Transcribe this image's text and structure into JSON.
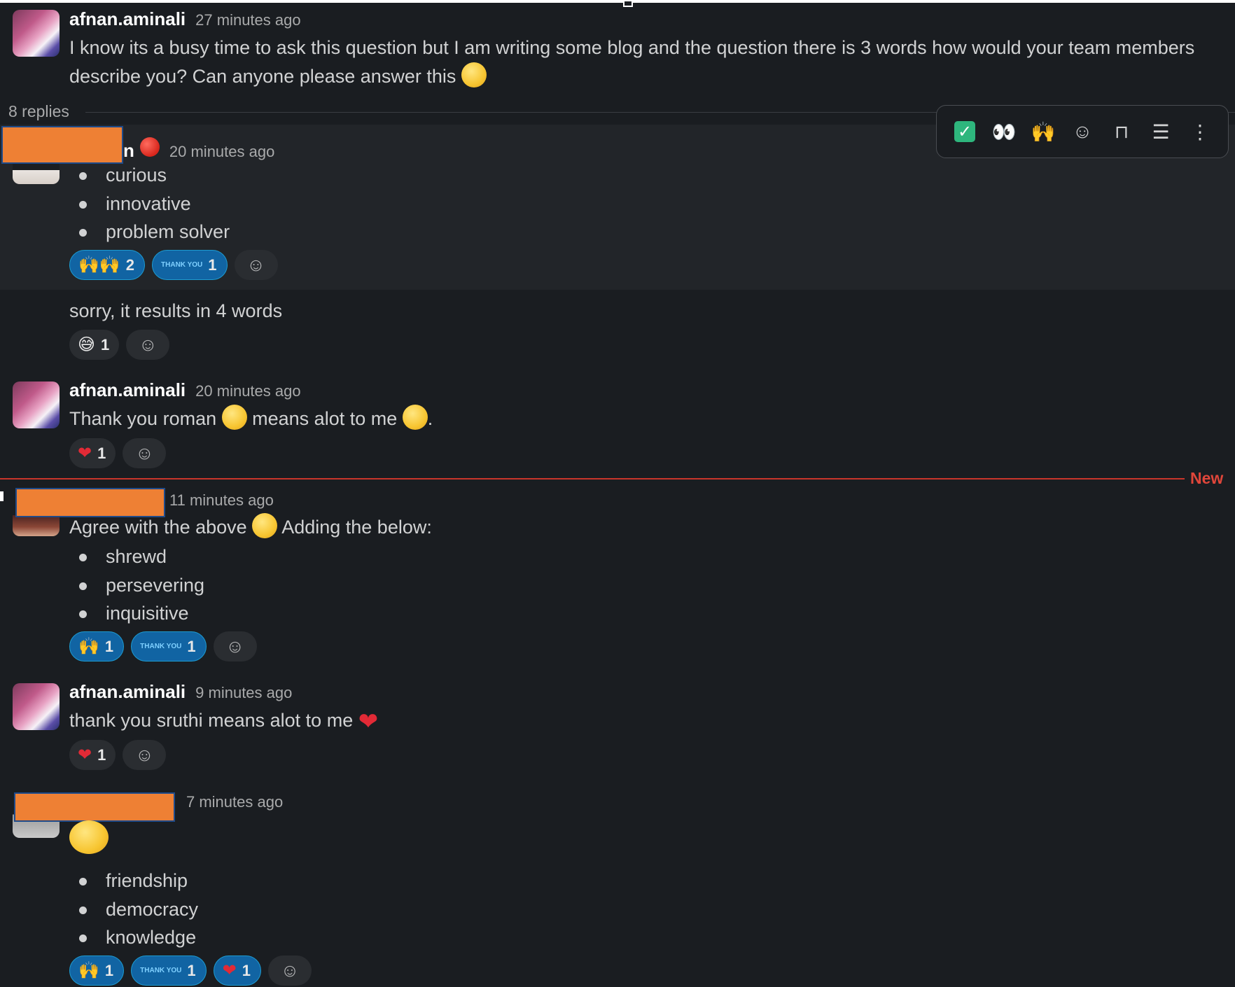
{
  "thread": {
    "replies_label": "8 replies",
    "new_label": "New"
  },
  "toolbar": {
    "icons": [
      "check-mark-icon",
      "eyes-icon",
      "raised-hands-icon",
      "add-reaction-icon",
      "bookmark-icon",
      "forward-icon",
      "more-icon"
    ]
  },
  "colors": {
    "accent": "#1164a3",
    "new_divider": "#c9352b",
    "redaction": "#ee8034",
    "background": "#1a1d21"
  },
  "messages": {
    "m1": {
      "author": "afnan.aminali",
      "time": "27 minutes ago",
      "text": "I know its a busy time to ask this question but I am writing some blog and the question there is 3 words how would your team members describe you? Can anyone please answer this"
    },
    "m2": {
      "author_suffix": "n",
      "time": "20 minutes ago",
      "bullets": [
        "curious",
        "innovative",
        "problem solver"
      ],
      "reactions": [
        {
          "icon": "🙌🙌",
          "count": "2"
        },
        {
          "icon": "THANK YOU",
          "count": "1"
        }
      ]
    },
    "m3": {
      "text": "sorry, it results in 4 words",
      "reactions": [
        {
          "icon": "😅",
          "count": "1"
        }
      ]
    },
    "m4": {
      "author": "afnan.aminali",
      "time": "20 minutes ago",
      "text_a": "Thank you roman",
      "text_b": "means alot to me",
      "text_c": ".",
      "reactions": [
        {
          "icon": "❤",
          "count": "1"
        }
      ]
    },
    "m5": {
      "time": "11 minutes ago",
      "text_a": "Agree with the above",
      "text_b": "Adding the below:",
      "bullets": [
        "shrewd",
        "persevering",
        "inquisitive"
      ],
      "reactions": [
        {
          "icon": "🙌",
          "count": "1"
        },
        {
          "icon": "THANK YOU",
          "count": "1"
        }
      ]
    },
    "m6": {
      "author": "afnan.aminali",
      "time": "9 minutes ago",
      "text": "thank you sruthi means alot to me",
      "reactions": [
        {
          "icon": "❤",
          "count": "1"
        }
      ]
    },
    "m7": {
      "time": "7 minutes ago",
      "bullets": [
        "friendship",
        "democracy",
        "knowledge"
      ],
      "reactions": [
        {
          "icon": "🙌",
          "count": "1"
        },
        {
          "icon": "THANK YOU",
          "count": "1"
        },
        {
          "icon": "❤",
          "count": "1"
        }
      ]
    }
  }
}
